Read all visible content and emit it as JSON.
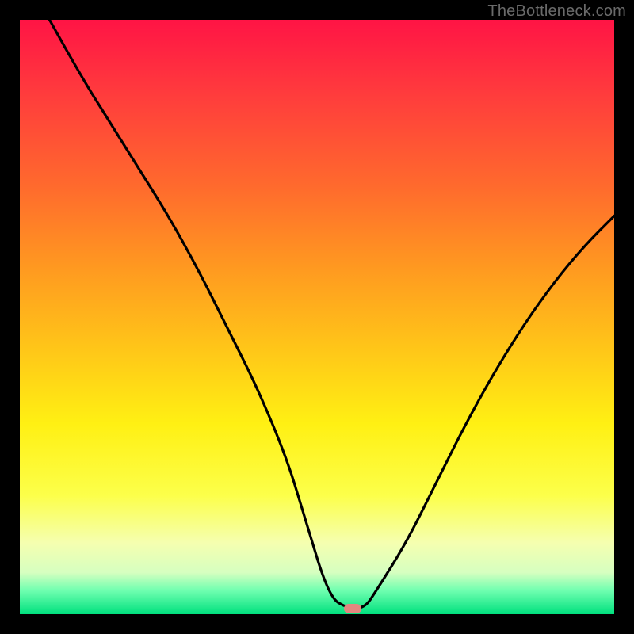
{
  "attribution": "TheBottleneck.com",
  "colors": {
    "frame": "#000000",
    "gradient_top": "#ff1445",
    "gradient_bottom": "#00e07e",
    "curve": "#000000",
    "marker": "#e2877f",
    "attribution_text": "#6a6a6a"
  },
  "chart_data": {
    "type": "line",
    "title": "",
    "xlabel": "",
    "ylabel": "",
    "xlim": [
      0,
      100
    ],
    "ylim": [
      0,
      100
    ],
    "grid": false,
    "series": [
      {
        "name": "bottleneck-curve",
        "x": [
          5,
          10,
          15,
          20,
          25,
          30,
          35,
          40,
          45,
          48,
          52,
          55,
          58,
          60,
          65,
          70,
          75,
          80,
          85,
          90,
          95,
          100
        ],
        "values": [
          100,
          91,
          83,
          75,
          67,
          58,
          48,
          38,
          26,
          16,
          3,
          1,
          1,
          4,
          12,
          22,
          32,
          41,
          49,
          56,
          62,
          67
        ]
      }
    ],
    "annotations": [
      {
        "name": "optimal-marker",
        "x": 56,
        "y": 1
      }
    ]
  }
}
